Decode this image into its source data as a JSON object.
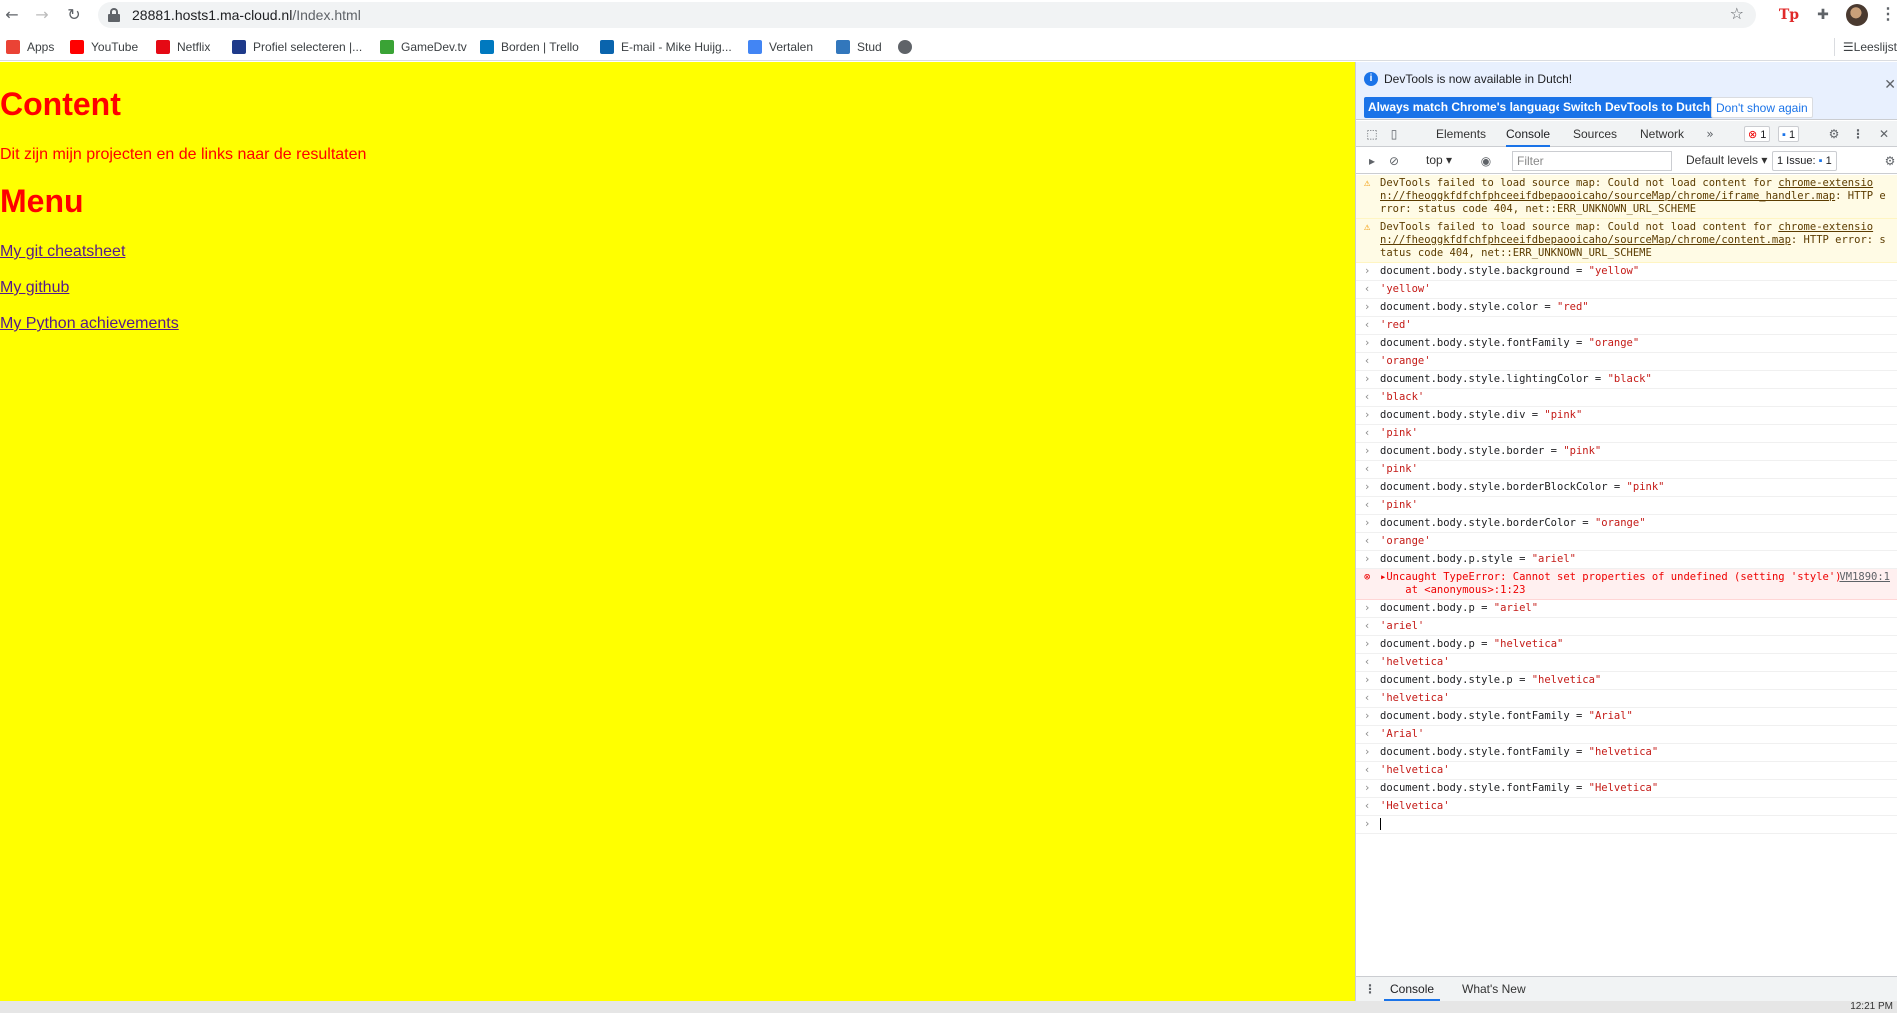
{
  "browser": {
    "url_host": "28881.hosts1.ma-cloud.nl",
    "url_path": "/Index.html"
  },
  "bookmarks": {
    "items": [
      {
        "label": "Apps",
        "icon": "apps-grid-icon",
        "color": "#ea4335"
      },
      {
        "label": "YouTube",
        "icon": "youtube-icon",
        "color": "#ff0000"
      },
      {
        "label": "Netflix",
        "icon": "netflix-icon",
        "color": "#e50914"
      },
      {
        "label": "Profiel selecteren |...",
        "icon": "disney-icon",
        "color": "#1e3a8a"
      },
      {
        "label": "GameDev.tv",
        "icon": "gamedev-icon",
        "color": "#3aa335"
      },
      {
        "label": "Borden | Trello",
        "icon": "trello-icon",
        "color": "#0079bf"
      },
      {
        "label": "E-mail - Mike Huijg...",
        "icon": "outlook-icon",
        "color": "#0a64ad"
      },
      {
        "label": "Vertalen",
        "icon": "translate-icon",
        "color": "#4285f4"
      },
      {
        "label": "Stud",
        "icon": "edge-icon",
        "color": "#3277bc"
      },
      {
        "label": "",
        "icon": "globe-icon",
        "color": "#5f6368"
      }
    ],
    "reading_list": "Leeslijst"
  },
  "page": {
    "heading_content": "Content",
    "intro": "Dit zijn mijn projecten en de links naar de resultaten",
    "heading_menu": "Menu",
    "links": [
      "My git cheatsheet",
      "My github",
      "My Python achievements"
    ],
    "background": "#ffff00",
    "text_color": "#ff0000"
  },
  "devtools": {
    "infobar": {
      "message": "DevTools is now available in Dutch!",
      "btn_match": "Always match Chrome's language",
      "btn_switch": "Switch DevTools to Dutch",
      "btn_dismiss": "Don't show again"
    },
    "tabs": [
      "Elements",
      "Console",
      "Sources",
      "Network"
    ],
    "error_count": "1",
    "message_count": "1",
    "context": "top",
    "filter_placeholder": "Filter",
    "levels": "Default levels",
    "issues": "1 Issue:",
    "issues_count": "1",
    "drawer_tabs": [
      "Console",
      "What's New"
    ]
  },
  "console": {
    "warnings": [
      {
        "text": "DevTools failed to load source map: Could not load content for ",
        "link": "chrome-extension://fheoggkfdfchfphceeifdbepaooicaho/sourceMap/chrome/iframe_handler.map",
        "tail": ": HTTP error: status code 404, net::ERR_UNKNOWN_URL_SCHEME"
      },
      {
        "text": "DevTools failed to load source map: Could not load content for ",
        "link": "chrome-extension://fheoggkfdfchfphceeifdbepaooicaho/sourceMap/chrome/content.map",
        "tail": ": HTTP error: status code 404, net::ERR_UNKNOWN_URL_SCHEME"
      }
    ],
    "entries": [
      {
        "cmd": "document.body.style.background = ",
        "str": "\"yellow\"",
        "result": "'yellow'"
      },
      {
        "cmd": "document.body.style.color = ",
        "str": "\"red\"",
        "result": "'red'"
      },
      {
        "cmd": "document.body.style.fontFamily = ",
        "str": "\"orange\"",
        "result": "'orange'"
      },
      {
        "cmd": "document.body.style.lightingColor = ",
        "str": "\"black\"",
        "result": "'black'"
      },
      {
        "cmd": "document.body.style.div = ",
        "str": "\"pink\"",
        "result": "'pink'"
      },
      {
        "cmd": "document.body.style.border = ",
        "str": "\"pink\"",
        "result": "'pink'"
      },
      {
        "cmd": "document.body.style.borderBlockColor = ",
        "str": "\"pink\"",
        "result": "'pink'"
      },
      {
        "cmd": "document.body.style.borderColor = ",
        "str": "\"orange\"",
        "result": "'orange'"
      }
    ],
    "error_cmd": {
      "cmd": "document.body.p.style = ",
      "str": "\"ariel\""
    },
    "error": {
      "message": "Uncaught TypeError: Cannot set properties of undefined (setting 'style')",
      "trace": "    at <anonymous>:1:23",
      "source": "VM1890:1"
    },
    "entries2": [
      {
        "cmd": "document.body.p = ",
        "str": "\"ariel\"",
        "result": "'ariel'"
      },
      {
        "cmd": "document.body.p = ",
        "str": "\"helvetica\"",
        "result": "'helvetica'"
      },
      {
        "cmd": "document.body.style.p = ",
        "str": "\"helvetica\"",
        "result": "'helvetica'"
      },
      {
        "cmd": "document.body.style.fontFamily = ",
        "str": "\"Arial\"",
        "result": "'Arial'"
      },
      {
        "cmd": "document.body.style.fontFamily = ",
        "str": "\"helvetica\"",
        "result": "'helvetica'"
      },
      {
        "cmd": "document.body.style.fontFamily = ",
        "str": "\"Helvetica\"",
        "result": "'Helvetica'"
      }
    ]
  },
  "taskbar": {
    "clock": "12:21 PM"
  }
}
